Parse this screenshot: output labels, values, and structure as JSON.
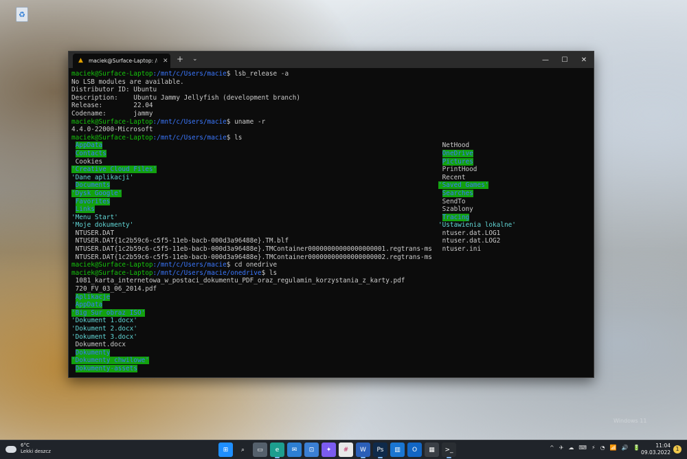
{
  "window": {
    "tab_title": "maciek@Surface-Laptop: /mnt/c",
    "new_tab": "+",
    "dropdown": "⌄",
    "min": "—",
    "max": "☐",
    "close": "✕"
  },
  "terminal": {
    "user": "maciek@Surface-Laptop",
    "path_home": ":/mnt/c/Users/macie",
    "path_onedrive": ":/mnt/c/Users/macie/onedrive",
    "dollar": "$ ",
    "cmd1": "lsb_release -a",
    "out1": "No LSB modules are available.",
    "out2": "Distributor ID: Ubuntu",
    "out3": "Description:    Ubuntu Jammy Jellyfish (development branch)",
    "out4": "Release:        22.04",
    "out5": "Codename:       jammy",
    "cmd2": "uname -r",
    "out6": "4.4.0-22000-Microsoft",
    "cmd3": "ls",
    "ls1": [
      {
        "l": "AppData",
        "ls": "dir",
        "r": "NetHood",
        "rs": "plain"
      },
      {
        "l": "Contacts",
        "ls": "dir",
        "r": "OneDrive",
        "rs": "dir"
      },
      {
        "l": "Cookies",
        "ls": "plain",
        "r": "Pictures",
        "rs": "dir"
      },
      {
        "l": "'Creative Cloud Files'",
        "ls": "dir",
        "r": "PrintHood",
        "rs": "plain"
      },
      {
        "l": "'Dane aplikacji'",
        "ls": "q",
        "r": "Recent",
        "rs": "plain"
      },
      {
        "l": "Documents",
        "ls": "dir",
        "r": "'Saved Games'",
        "rs": "dir"
      },
      {
        "l": "'Dysk Google'",
        "ls": "dir",
        "r": "Searches",
        "rs": "dir"
      },
      {
        "l": "Favorites",
        "ls": "dir",
        "r": "SendTo",
        "rs": "plain"
      },
      {
        "l": "Links",
        "ls": "dir",
        "r": "Szablony",
        "rs": "plain"
      },
      {
        "l": "'Menu Start'",
        "ls": "q",
        "r": "Tracing",
        "rs": "dir"
      },
      {
        "l": "'Moje dokumenty'",
        "ls": "q",
        "r": "'Ustawienia lokalne'",
        "rs": "q"
      },
      {
        "l": "NTUSER.DAT",
        "ls": "plain",
        "r": "ntuser.dat.LOG1",
        "rs": "plain"
      },
      {
        "l": "NTUSER.DAT{1c2b59c6-c5f5-11eb-bacb-000d3a96488e}.TM.blf",
        "ls": "plain",
        "r": "ntuser.dat.LOG2",
        "rs": "plain"
      },
      {
        "l": "NTUSER.DAT{1c2b59c6-c5f5-11eb-bacb-000d3a96488e}.TMContainer00000000000000000001.regtrans-ms",
        "ls": "plain",
        "r": "ntuser.ini",
        "rs": "plain"
      },
      {
        "l": "NTUSER.DAT{1c2b59c6-c5f5-11eb-bacb-000d3a96488e}.TMContainer00000000000000000002.regtrans-ms",
        "ls": "plain",
        "r": "",
        "rs": "plain"
      }
    ],
    "cmd4": "cd onedrive",
    "cmd5": "ls",
    "ls2": [
      {
        "l": "1081_karta_internetowa_w_postaci_dokumentu_PDF_oraz_regulamin_korzystania_z_karty.pdf",
        "ls": "plain"
      },
      {
        "l": "720_FV_03_06_2014.pdf",
        "ls": "plain"
      },
      {
        "l": "Aplikacje",
        "ls": "dir"
      },
      {
        "l": "AppData",
        "ls": "dir"
      },
      {
        "l": "'Big Sur obraz ISO'",
        "ls": "dir"
      },
      {
        "l": "'Dokument 1.docx'",
        "ls": "q"
      },
      {
        "l": "'Dokument 2.docx'",
        "ls": "q"
      },
      {
        "l": "'Dokument 3.docx'",
        "ls": "q"
      },
      {
        "l": "Dokument.docx",
        "ls": "plain"
      },
      {
        "l": "Dokumenty",
        "ls": "dir"
      },
      {
        "l": "'Dokumenty chwilowe'",
        "ls": "dir"
      },
      {
        "l": "Dokumenty-assets",
        "ls": "dir"
      }
    ]
  },
  "taskbar": {
    "weather_temp": "6°C",
    "weather_desc": "Lekki deszcz",
    "icons": [
      "windows-start-icon",
      "search-icon",
      "task-view-icon",
      "edge-icon",
      "mail-icon",
      "store-icon",
      "messenger-icon",
      "slack-icon",
      "word-icon",
      "photoshop-icon",
      "trello-icon",
      "outlook-icon",
      "calculator-icon",
      "terminal-icon"
    ],
    "tray": [
      "^",
      "✈",
      "☁",
      "⌨",
      "⚡",
      "◔",
      "📶",
      "🔊",
      "🔋"
    ],
    "time": "11:04",
    "date": "09.03.2022",
    "notifications": "1"
  },
  "watermark": "Windows 11"
}
